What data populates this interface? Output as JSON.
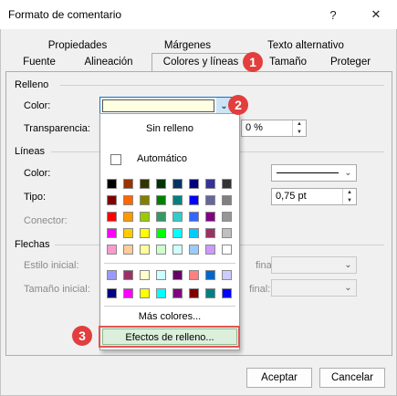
{
  "window": {
    "title": "Formato de comentario",
    "help": "?",
    "close": "✕"
  },
  "tabs_row1": [
    "Propiedades",
    "Márgenes",
    "Texto alternativo"
  ],
  "tabs_row2": [
    "Fuente",
    "Alineación",
    "Colores y líneas",
    "Tamaño",
    "Proteger"
  ],
  "fill": {
    "section": "Relleno",
    "color_label": "Color:",
    "transparency_label": "Transparencia:",
    "transparency_value": "0 %"
  },
  "lines": {
    "section": "Líneas",
    "color_label": "Color:",
    "type_label": "Tipo:",
    "connector_label": "Conector:",
    "weight_value": "0,75 pt"
  },
  "arrows": {
    "section": "Flechas",
    "start_style_label": "Estilo inicial:",
    "start_size_label": "Tamaño inicial:",
    "end_style_label_partial": "final:",
    "end_size_label_partial": "final:"
  },
  "popup": {
    "no_fill": "Sin relleno",
    "automatic": "Automático",
    "more_colors": "Más colores...",
    "fill_effects": "Efectos de relleno...",
    "grid_colors": [
      [
        "#000000",
        "#993300",
        "#333300",
        "#003300",
        "#003366",
        "#000080",
        "#333399",
        "#333333"
      ],
      [
        "#800000",
        "#FF6600",
        "#808000",
        "#008000",
        "#008080",
        "#0000FF",
        "#666699",
        "#808080"
      ],
      [
        "#FF0000",
        "#FF9900",
        "#99CC00",
        "#339966",
        "#33CCCC",
        "#3366FF",
        "#800080",
        "#969696"
      ],
      [
        "#FF00FF",
        "#FFCC00",
        "#FFFF00",
        "#00FF00",
        "#00FFFF",
        "#00CCFF",
        "#993366",
        "#C0C0C0"
      ],
      [
        "#FF99CC",
        "#FFCC99",
        "#FFFF99",
        "#CCFFCC",
        "#CCFFFF",
        "#99CCFF",
        "#CC99FF",
        "#FFFFFF"
      ]
    ],
    "extra_colors": [
      [
        "#9999FF",
        "#993366",
        "#FFFFCC",
        "#CCFFFF",
        "#660066",
        "#FF8080",
        "#0066CC",
        "#CCCCFF"
      ],
      [
        "#000080",
        "#FF00FF",
        "#FFFF00",
        "#00FFFF",
        "#800080",
        "#800000",
        "#008080",
        "#0000FF"
      ]
    ]
  },
  "selected_fill_color": "#FFFFE1",
  "badges": [
    "1",
    "2",
    "3"
  ],
  "badge_color": "#E23E3E",
  "buttons": {
    "ok": "Aceptar",
    "cancel": "Cancelar"
  }
}
